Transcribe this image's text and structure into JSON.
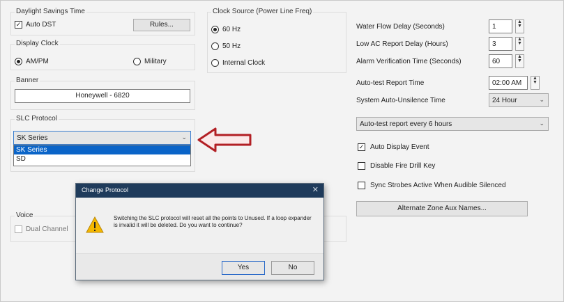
{
  "daylight": {
    "group_title": "Daylight Savings Time",
    "auto_dst_label": "Auto DST",
    "auto_dst_checked": true,
    "rules_button": "Rules..."
  },
  "display_clock": {
    "group_title": "Display Clock",
    "ampm_label": "AM/PM",
    "military_label": "Military",
    "selected": "AM/PM"
  },
  "banner": {
    "group_title": "Banner",
    "value": "Honeywell - 6820"
  },
  "slc": {
    "group_title": "SLC Protocol",
    "selected": "SK Series",
    "options": [
      "SK Series",
      "SD"
    ]
  },
  "voice": {
    "group_title": "Voice",
    "dual_channel_label": "Dual Channel",
    "dual_channel_checked": false
  },
  "clock_source": {
    "group_title": "Clock Source (Power Line Freq)",
    "options": [
      "60 Hz",
      "50 Hz",
      "Internal Clock"
    ],
    "selected": "60 Hz"
  },
  "settings": {
    "water_flow_label": "Water Flow Delay (Seconds)",
    "water_flow_value": "1",
    "low_ac_label": "Low AC Report Delay (Hours)",
    "low_ac_value": "3",
    "alarm_verif_label": "Alarm Verification Time (Seconds)",
    "alarm_verif_value": "60",
    "autotest_time_label": "Auto-test Report Time",
    "autotest_time_value": "02:00 AM",
    "sync_unsilence_label": "System Auto-Unsilence Time",
    "sync_unsilence_value": "24 Hour",
    "autotest_report_value": "Auto-test report every 6 hours",
    "auto_display_label": "Auto Display Event",
    "auto_display_checked": true,
    "disable_fire_drill_label": "Disable Fire Drill Key",
    "disable_fire_drill_checked": false,
    "sync_strobes_label": "Sync Strobes Active When Audible Silenced",
    "sync_strobes_checked": false,
    "alt_zone_button": "Alternate Zone Aux Names..."
  },
  "dialog": {
    "title": "Change Protocol",
    "message": "Switching the SLC protocol will reset all the points to Unused. If a loop expander is invalid it will be deleted. Do you want to continue?",
    "yes": "Yes",
    "no": "No"
  },
  "colors": {
    "arrow": "#b21f24",
    "selection": "#0a64c8",
    "dialog_title_bar": "#1f3b5b",
    "warning": "#f5b800"
  },
  "icons": {
    "arrow": "left-arrow-icon",
    "warning": "warning-icon"
  }
}
